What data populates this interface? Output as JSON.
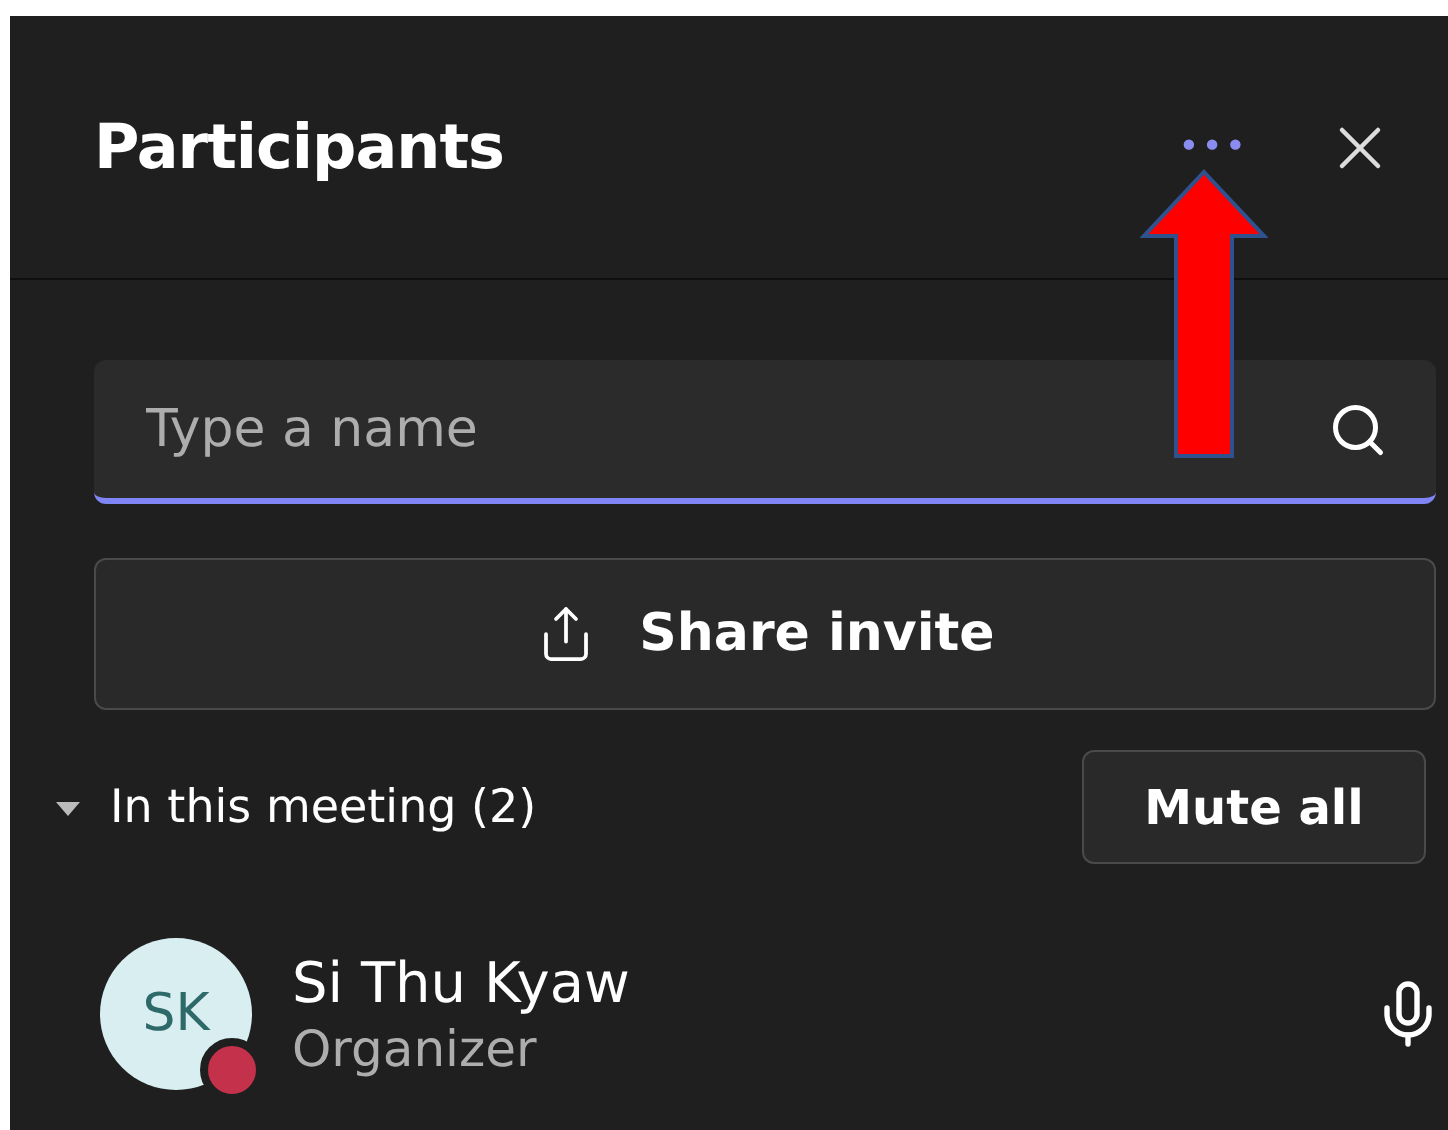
{
  "header": {
    "title": "Participants",
    "more_label": "•••"
  },
  "search": {
    "placeholder": "Type a name"
  },
  "share_button": {
    "label": "Share invite"
  },
  "section": {
    "label": "In this meeting (2)",
    "expanded": true,
    "action": "Mute all"
  },
  "participants": [
    {
      "initials": "SK",
      "name": "Si Thu Kyaw",
      "role": "Organizer",
      "color": "#c4314b",
      "muted": false
    }
  ]
}
